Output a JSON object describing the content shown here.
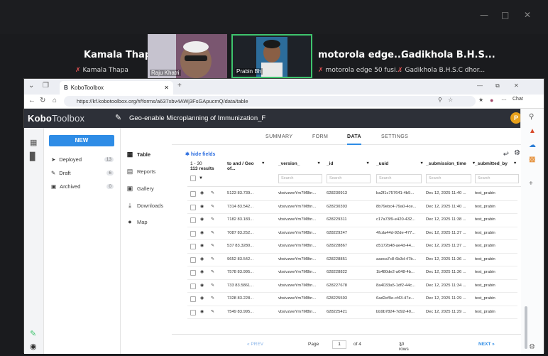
{
  "meeting": {
    "participants": [
      {
        "name": "Kamala Thapa",
        "label": "Kamala Thapa"
      },
      {
        "name": "",
        "label": "Raju Khatri"
      },
      {
        "name": "",
        "label": "Prabin Bh"
      },
      {
        "name": "motorola edge...",
        "label": "motorola edge 50 fusi..."
      },
      {
        "name": "Gadikhola B.H.S...",
        "label": "Gadikhola B.H.S.C dhor..."
      }
    ]
  },
  "browser": {
    "tab_title": "KoboToolbox",
    "url": "https://kf.kobotoolbox.org/#/forms/a637xbv4AWj3FsGApucmQ/data/table",
    "chat_label": "Chat"
  },
  "kobo": {
    "logo_bold": "Kobo",
    "logo_light": "Toolbox",
    "project_title": "Geo-enable Microplanning of Immunization_F",
    "avatar_letter": "P",
    "new_button": "NEW",
    "sidebar": [
      {
        "label": "Deployed",
        "count": "13"
      },
      {
        "label": "Draft",
        "count": "6"
      },
      {
        "label": "Archived",
        "count": "0"
      }
    ],
    "form_nav": [
      "Table",
      "Reports",
      "Gallery",
      "Downloads",
      "Map"
    ],
    "tabs": [
      "SUMMARY",
      "FORM",
      "DATA",
      "SETTINGS"
    ],
    "hide_fields": "hide fields",
    "results": [
      "1 - 30",
      "113 results"
    ],
    "columns": [
      "to and / Geo of...",
      "_version_",
      "_id",
      "_uuid",
      "_submission_time",
      "_submitted_by"
    ],
    "filter_placeholder": "Search",
    "rows": [
      {
        "geo": "5123 83.739...",
        "version": "vbsivzweYm7M8tn...",
        "id": "628230913",
        "uuid": "ba2f1c757641-4b5...",
        "time": "Dec 12, 2025 11:40 ...",
        "by": "test_prabin"
      },
      {
        "geo": "7314 83.542...",
        "version": "vbsivzweYm7M8tn...",
        "id": "628230393",
        "uuid": "8b79ebc4-79a0-4ce...",
        "time": "Dec 12, 2025 11:40 ...",
        "by": "test_prabin"
      },
      {
        "geo": "7182 83.183...",
        "version": "vbsivzweYm7M8tn...",
        "id": "628229311",
        "uuid": "c17a73f9-e420-432...",
        "time": "Dec 12, 2025 11:38 ...",
        "by": "test_prabin"
      },
      {
        "geo": "7087 83.252...",
        "version": "vbsivzweYm7M8tn...",
        "id": "628229247",
        "uuid": "4fcda44d-92de-477...",
        "time": "Dec 12, 2025 11:37 ...",
        "by": "test_prabin"
      },
      {
        "geo": "537 83.3280...",
        "version": "vbsivzweYm7M8tn...",
        "id": "628228867",
        "uuid": "d5172b48-ae4d-44...",
        "time": "Dec 12, 2025 11:37 ...",
        "by": "test_prabin"
      },
      {
        "geo": "9652 83.542...",
        "version": "vbsivzweYm7M8tn...",
        "id": "628228851",
        "uuid": "aaeca7c8-6b3d-47b...",
        "time": "Dec 12, 2025 11:36 ...",
        "by": "test_prabin"
      },
      {
        "geo": "7578 83.995...",
        "version": "vbsivzweYm7M8tn...",
        "id": "628228822",
        "uuid": "1b480de2-a648-4b...",
        "time": "Dec 12, 2025 11:36 ...",
        "by": "test_prabin"
      },
      {
        "geo": "733 83.5861...",
        "version": "vbsivzweYm7M8tn...",
        "id": "628227678",
        "uuid": "8a4033a5-1df2-44c...",
        "time": "Dec 12, 2025 11:34 ...",
        "by": "test_prabin"
      },
      {
        "geo": "7328 83.228...",
        "version": "vbsivzweYm7M8tn...",
        "id": "628225593",
        "uuid": "6ad2ef9e-cf43-47e...",
        "time": "Dec 12, 2025 11:29 ...",
        "by": "test_prabin"
      },
      {
        "geo": "7549 83.995...",
        "version": "vbsivzweYm7M8tn...",
        "id": "628225421",
        "uuid": "bb9b7824-7d92-40...",
        "time": "Dec 12, 2025 11:29 ...",
        "by": "test_prabin"
      }
    ],
    "pager": {
      "prev": "« PREV",
      "page_label": "Page",
      "page": "1",
      "of": "of 4",
      "rows": "30 rows",
      "next": "NEXT »"
    }
  },
  "colors": {
    "accent": "#2e8ce6",
    "header": "#2d3038",
    "speaker_border": "#3ec46d"
  }
}
